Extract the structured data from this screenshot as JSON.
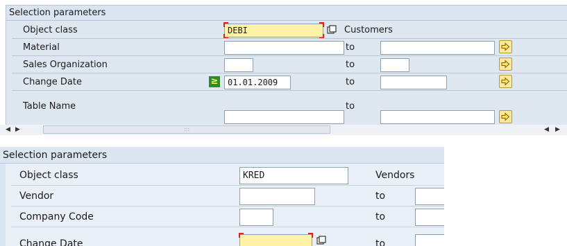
{
  "panel1": {
    "title": "Selection parameters",
    "rows": [
      {
        "label": "Object class",
        "value": "DEBI",
        "description": "Customers"
      },
      {
        "label": "Material",
        "to": "to"
      },
      {
        "label": "Sales Organization",
        "to": "to"
      },
      {
        "label": "Change Date",
        "value": "01.01.2009",
        "to": "to"
      },
      {
        "label": "Table Name",
        "to": "to"
      }
    ],
    "scrollbar": {
      "grip": ":::"
    }
  },
  "panel2": {
    "title": "Selection parameters",
    "rows": [
      {
        "label": "Object class",
        "value": "KRED",
        "description": "Vendors"
      },
      {
        "label": "Vendor",
        "to": "to"
      },
      {
        "label": "Company Code",
        "to": "to"
      },
      {
        "label": "Change Date",
        "to": "to"
      }
    ]
  },
  "colors": {
    "required_marker": "#e02020",
    "highlight_field": "#fff3a8",
    "panel_background": "#dfe7f0"
  },
  "icons": {
    "value_help": "value-help-icon",
    "multiple_selection": "multiple-selection-arrow-icon",
    "greater_equal": "greater-equal-icon"
  }
}
